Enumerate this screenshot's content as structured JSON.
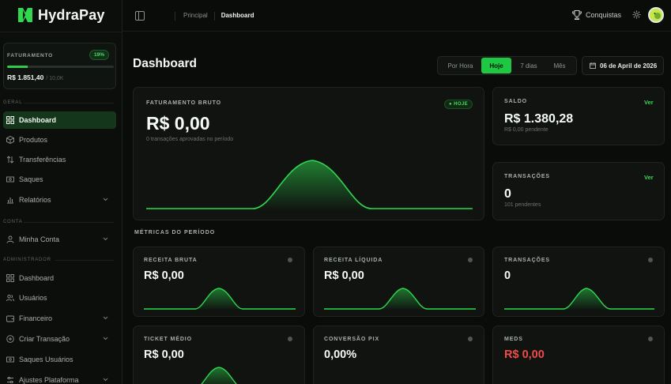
{
  "app": {
    "name": "HydraPay"
  },
  "sidebar": {
    "revenue_card": {
      "label": "FATURAMENTO",
      "percent_label": "19%",
      "progress_fraction": 0.19,
      "amount": "R$ 1.851,40",
      "goal": "/ 10,0K"
    },
    "sections": [
      {
        "label": "GERAL"
      },
      {
        "label": "CONTA"
      },
      {
        "label": "ADMINISTRADOR"
      }
    ],
    "items": [
      {
        "label": "Dashboard",
        "icon": "grid-icon",
        "active": true
      },
      {
        "label": "Produtos",
        "icon": "box-icon"
      },
      {
        "label": "Transferências",
        "icon": "arrows-icon"
      },
      {
        "label": "Saques",
        "icon": "cash-icon"
      },
      {
        "label": "Relatórios",
        "icon": "bar-chart-icon",
        "expandable": true
      },
      {
        "label": "Minha Conta",
        "icon": "user-icon",
        "expandable": true
      },
      {
        "label": "Dashboard",
        "icon": "grid-icon"
      },
      {
        "label": "Usuários",
        "icon": "users-icon"
      },
      {
        "label": "Financeiro",
        "icon": "wallet-icon",
        "expandable": true
      },
      {
        "label": "Criar Transação",
        "icon": "plus-circle-icon",
        "expandable": true
      },
      {
        "label": "Saques Usuários",
        "icon": "cash-icon"
      },
      {
        "label": "Ajustes Plataforma",
        "icon": "sliders-icon",
        "expandable": true
      }
    ]
  },
  "header": {
    "breadcrumb": [
      "Principal",
      "Dashboard"
    ],
    "achievements_label": "Conquistas"
  },
  "main": {
    "title": "Dashboard",
    "periods": [
      "Por Hora",
      "Hoje",
      "7 dias",
      "Mês"
    ],
    "active_period": "Hoje",
    "date": "06 de April de 2026",
    "gross": {
      "label": "FATURAMENTO BRUTO",
      "badge": "HOJE",
      "value": "R$ 0,00",
      "sub": "0 transações aprovadas no período"
    },
    "balance": {
      "label": "SALDO",
      "link": "Ver",
      "value": "R$ 1.380,28",
      "sub": "R$ 0,00 pendente"
    },
    "transactions": {
      "label": "TRANSAÇÕES",
      "link": "Ver",
      "value": "0",
      "sub": "101 pendentes"
    },
    "metrics_title": "MÉTRICAS DO PERÍODO",
    "metrics": [
      {
        "label": "RECEITA BRUTA",
        "value": "R$ 0,00"
      },
      {
        "label": "RECEITA LÍQUIDA",
        "value": "R$ 0,00"
      },
      {
        "label": "TRANSAÇÕES",
        "value": "0"
      },
      {
        "label": "TICKET MÉDIO",
        "value": "R$ 0,00"
      },
      {
        "label": "CONVERSÃO PIX",
        "value": "0,00%"
      },
      {
        "label": "MEDS",
        "value": "R$ 0,00",
        "color": "#f04b4b"
      }
    ]
  },
  "colors": {
    "accent": "#1fc842",
    "line": "#2fd84f",
    "negative": "#f04b4b"
  }
}
